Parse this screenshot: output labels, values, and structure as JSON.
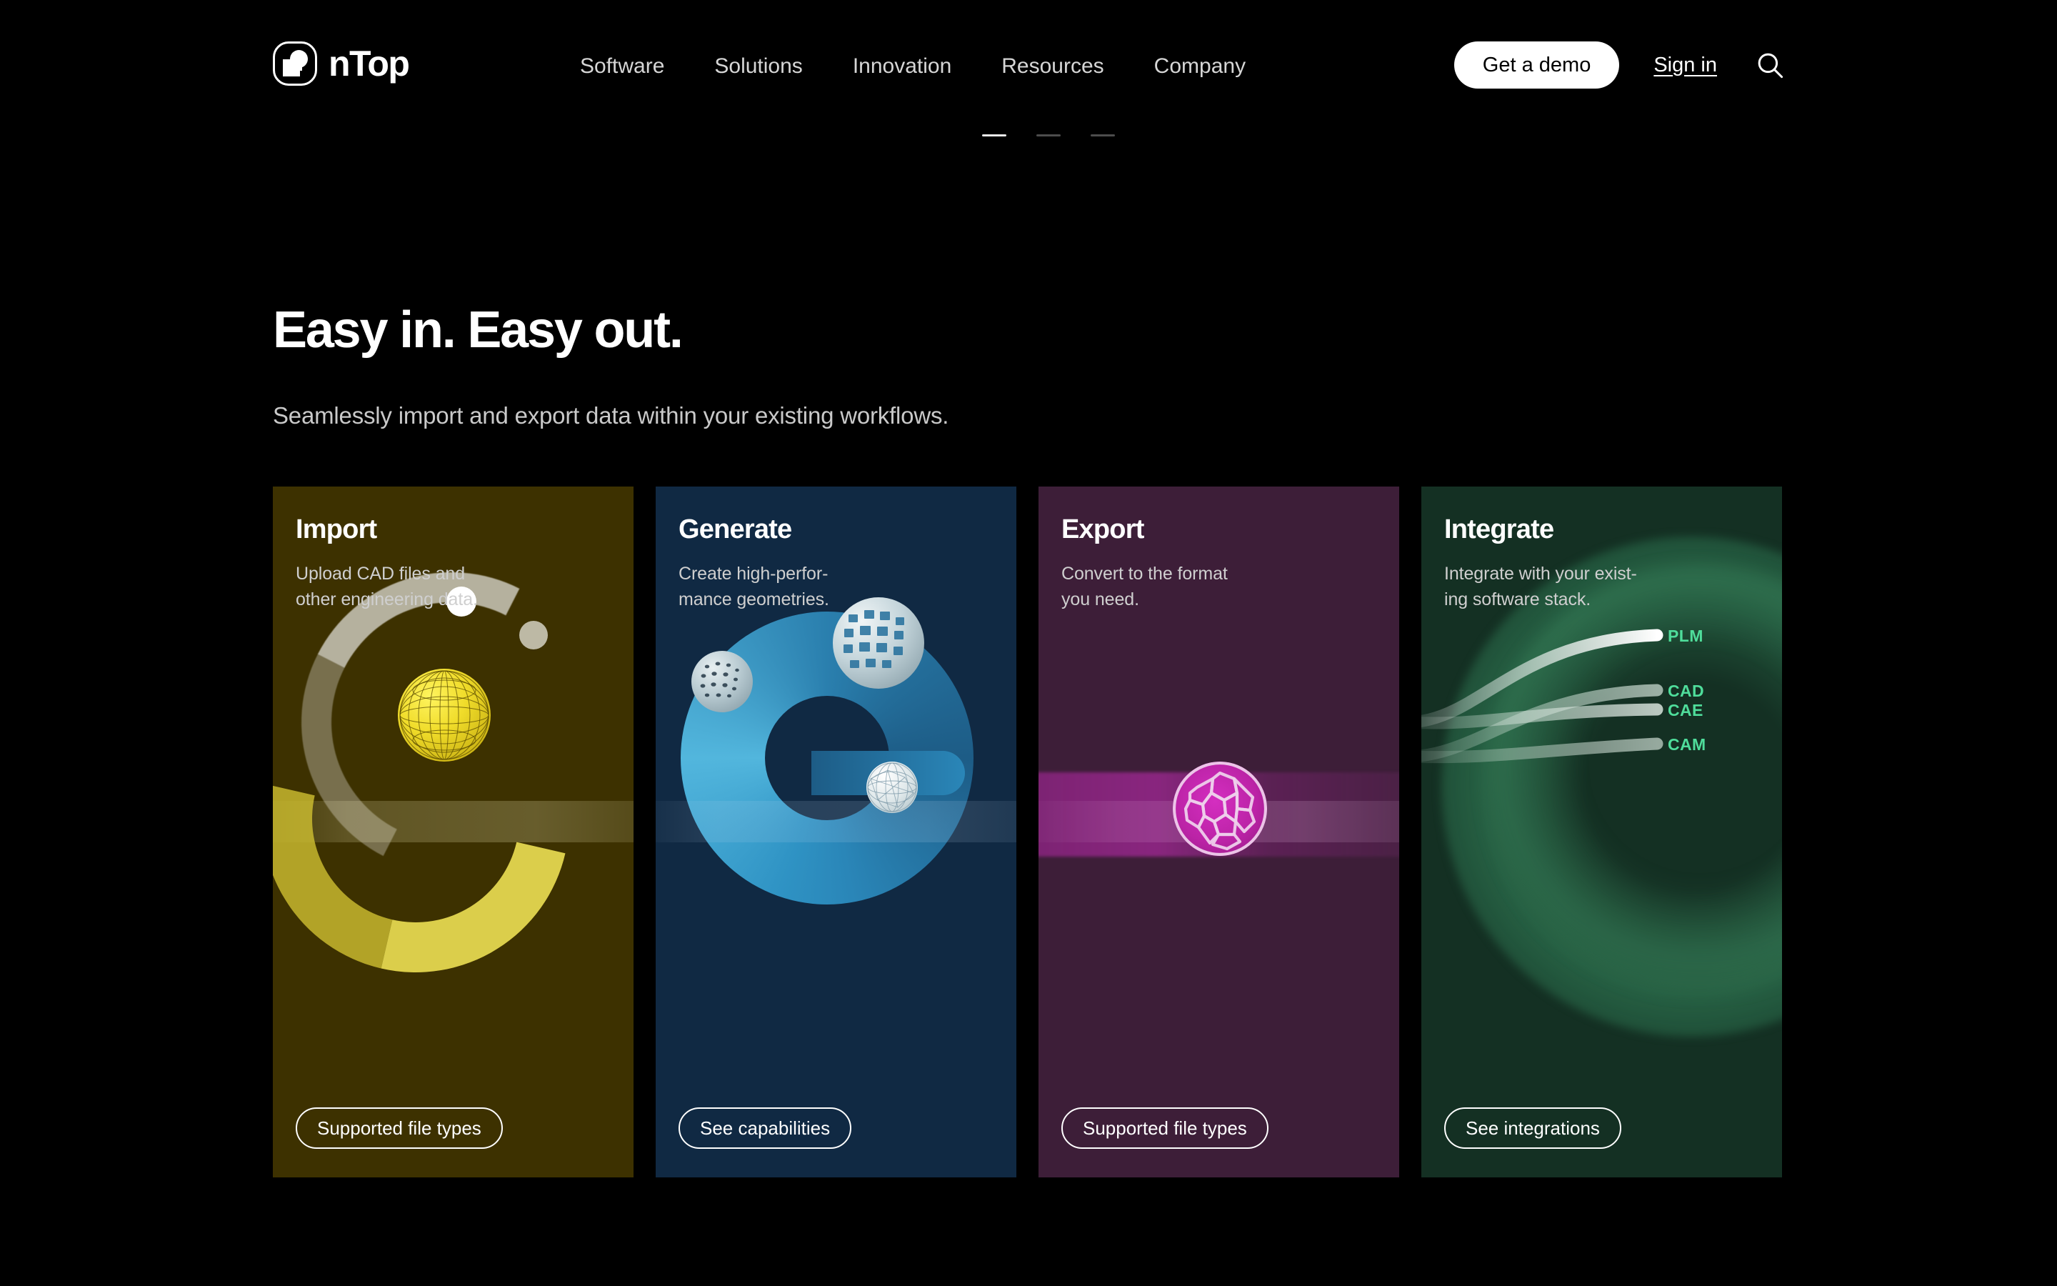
{
  "header": {
    "brand": {
      "name": "nTop",
      "logo_icon": "ntop-logo-icon"
    },
    "nav": [
      {
        "label": "Software"
      },
      {
        "label": "Solutions"
      },
      {
        "label": "Innovation"
      },
      {
        "label": "Resources"
      },
      {
        "label": "Company"
      }
    ],
    "demo_button": "Get a demo",
    "signin_link": "Sign in",
    "search_icon": "search-icon"
  },
  "carousel": {
    "dots": [
      "",
      "",
      ""
    ],
    "active_index": 0
  },
  "main": {
    "title": "Easy in. Easy out.",
    "subtitle": "Seamlessly import and export data within your existing workflows."
  },
  "cards": [
    {
      "id": "import",
      "title": "Import",
      "description": "Upload CAD files and\nother engineering data.",
      "cta": "Supported file types",
      "bg_color": "#3d3100",
      "accent_color": "#e9dc52"
    },
    {
      "id": "generate",
      "title": "Generate",
      "description": "Create high-perfor-\nmance geometries.",
      "cta": "See capabilities",
      "bg_color": "#102943",
      "accent_color": "#3f9fcd"
    },
    {
      "id": "export",
      "title": "Export",
      "description": "Convert to the format\nyou need.",
      "cta": "Supported file types",
      "bg_color": "#3d1e38",
      "accent_color": "#c42eb0"
    },
    {
      "id": "integrate",
      "title": "Integrate",
      "description": "Integrate with your exist-\ning software stack.",
      "cta": "See integrations",
      "bg_color": "#143023",
      "accent_color": "#4fdd9b",
      "connector_labels": [
        "PLM",
        "CAD",
        "CAE",
        "CAM"
      ]
    }
  ]
}
